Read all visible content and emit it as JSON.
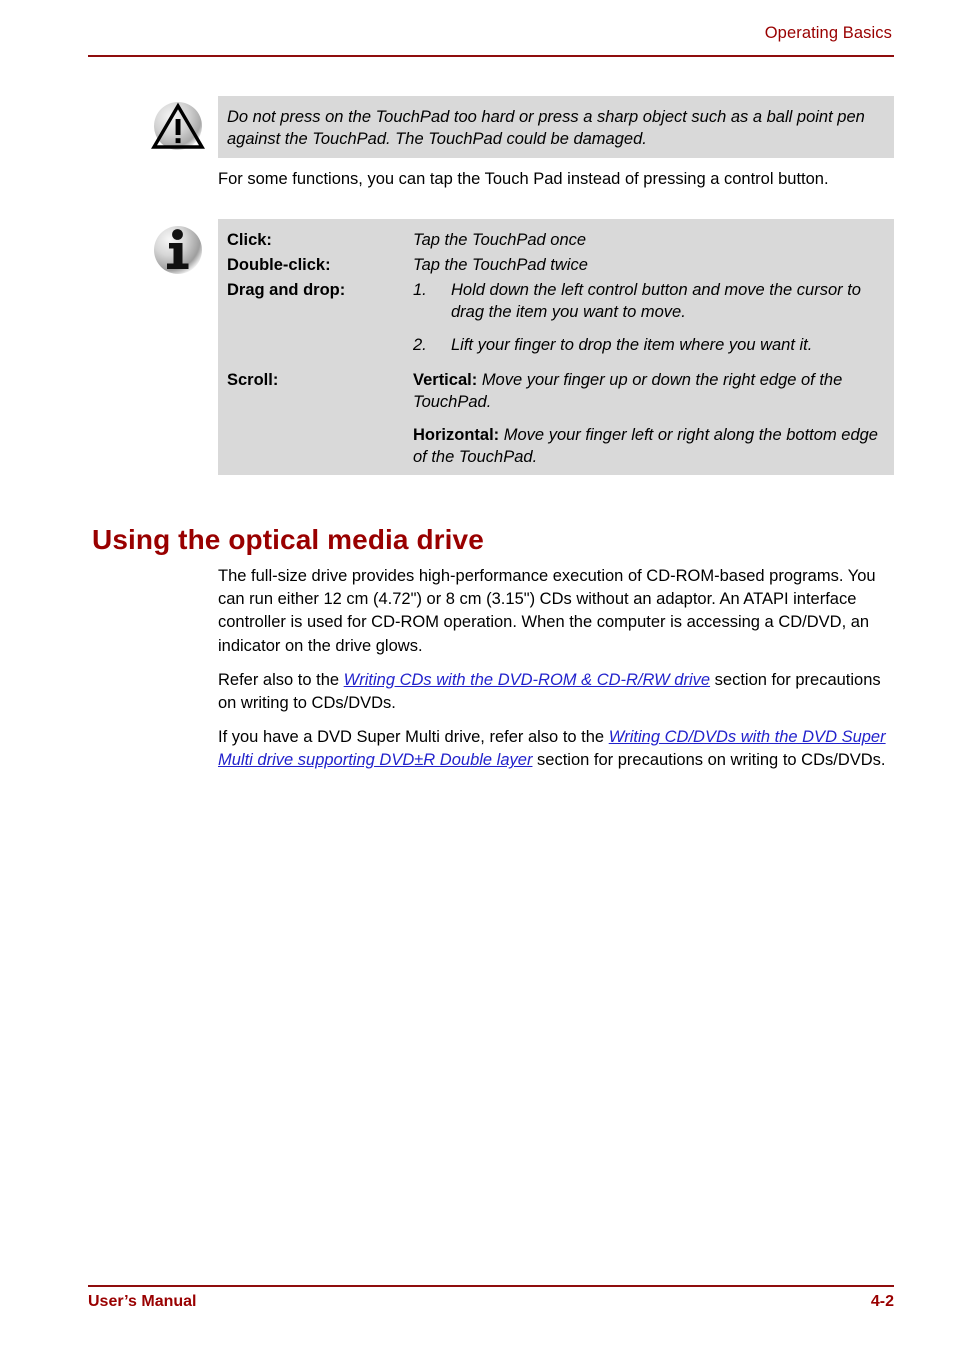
{
  "header": {
    "title": "Operating Basics"
  },
  "warning_callout": {
    "icon": "warning-triangle-icon",
    "text": "Do not press on the TouchPad too hard or press a sharp object such as a ball point pen against the TouchPad. The TouchPad could be damaged."
  },
  "intro_paragraph": "For some functions, you can tap the Touch Pad instead of pressing a control button.",
  "info_callout": {
    "icon": "information-icon",
    "rows": [
      {
        "term": "Click:",
        "definition": "Tap the TouchPad once"
      },
      {
        "term": "Double-click:",
        "definition": "Tap the TouchPad twice"
      },
      {
        "term": "Drag and drop:",
        "step1_num": "1.",
        "step1_text": "Hold down the left control button and move the cursor to drag the item you want to move.",
        "step2_num": "2.",
        "step2_text": "Lift your finger to drop the item where you want it."
      },
      {
        "term": "Scroll:",
        "vertical_label": "Vertical:",
        "vertical_text": "Move your finger up or down the right edge of the TouchPad.",
        "horizontal_label": "Horizontal:",
        "horizontal_text": "Move your finger left or right along the bottom edge of the TouchPad."
      }
    ]
  },
  "section": {
    "heading": "Using the optical media drive",
    "paragraph1": "The full-size drive provides high-performance execution of CD-ROM-based programs. You can run either 12 cm (4.72\") or 8 cm (3.15\") CDs without an adaptor. An ATAPI interface controller is used for CD-ROM operation. When the computer is accessing a CD/DVD, an indicator on the drive glows.",
    "paragraph2_before": "Refer also to the ",
    "paragraph2_link": "Writing CDs with the DVD-ROM & CD-R/RW drive",
    "paragraph2_after": " section for precautions on writing to CDs/DVDs.",
    "paragraph3_before": "If you have a DVD Super Multi drive, refer also to the ",
    "paragraph3_link": "Writing CD/DVDs with the DVD Super Multi drive supporting DVD±R Double layer",
    "paragraph3_after": " section for precautions on writing to CDs/DVDs."
  },
  "footer": {
    "left": "User’s Manual",
    "right": "4-2"
  },
  "colors": {
    "accent_red": "#990000",
    "rule_red": "#8f0d0d",
    "callout_gray": "#d9d9d9",
    "link_blue": "#2222cc"
  }
}
